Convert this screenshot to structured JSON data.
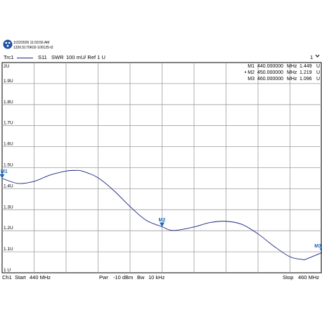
{
  "header": {
    "date_line": "1/22/2026 11:03:56 AM",
    "id_line": "1326.5170K02-100125-t2"
  },
  "trace_bar": {
    "trace": "Trc1",
    "param": "S11",
    "format": "SWR",
    "scale": "100 mU/ Ref 1 U",
    "channel_indicator": "1",
    "dropdown_icon": "chevron-down-icon"
  },
  "markers": [
    {
      "label": "M1",
      "active": false,
      "freq": "440.000000",
      "freq_unit": "MHz",
      "value": "1.449",
      "unit": "U"
    },
    {
      "label": "M2",
      "active": true,
      "freq": "450.000000",
      "freq_unit": "MHz",
      "value": "1.219",
      "unit": "U"
    },
    {
      "label": "M3",
      "active": false,
      "freq": "460.000000",
      "freq_unit": "MHz",
      "value": "1.096",
      "unit": "U"
    }
  ],
  "bottom_bar": {
    "channel": "Ch1",
    "start_label": "Start",
    "start_value": "440 MHz",
    "pwr_label": "Pwr",
    "pwr_value": "-10 dBm",
    "bw_label": "Bw",
    "bw_value": "10 kHz",
    "stop_label": "Stop",
    "stop_value": "460 MHz"
  },
  "colors": {
    "trace": "#1a237e",
    "marker": "#1565c0",
    "grid": "#9e9e9e",
    "text": "#000000"
  },
  "chart_data": {
    "type": "line",
    "title": "",
    "xlabel": "",
    "ylabel": "",
    "xlim": [
      440,
      460
    ],
    "ylim": [
      1.0,
      2.0
    ],
    "grid": true,
    "x_divisions": 10,
    "y_tick_labels": [
      "2U",
      "1.9U",
      "1.8U",
      "1.7U",
      "1.6U",
      "1.5U",
      "1.4U",
      "1.3U",
      "1.2U",
      "1.1U",
      "1 U"
    ],
    "y_ticks": [
      2.0,
      1.9,
      1.8,
      1.7,
      1.6,
      1.5,
      1.4,
      1.3,
      1.2,
      1.1,
      1.0
    ],
    "series": [
      {
        "x": [
          440,
          441,
          442,
          443,
          444,
          444.5,
          445,
          446,
          447,
          448,
          449,
          450,
          450.5,
          451,
          452,
          453,
          454,
          455,
          456,
          457,
          458,
          458.8,
          459,
          460
        ],
        "values": [
          1.449,
          1.425,
          1.435,
          1.465,
          1.484,
          1.487,
          1.484,
          1.452,
          1.39,
          1.315,
          1.25,
          1.219,
          1.203,
          1.203,
          1.218,
          1.239,
          1.245,
          1.23,
          1.185,
          1.126,
          1.076,
          1.063,
          1.065,
          1.096
        ]
      }
    ],
    "marker_points": [
      {
        "label": "M1",
        "x": 440,
        "y": 1.449
      },
      {
        "label": "M2",
        "x": 450,
        "y": 1.219
      },
      {
        "label": "M3",
        "x": 460,
        "y": 1.096
      }
    ]
  }
}
